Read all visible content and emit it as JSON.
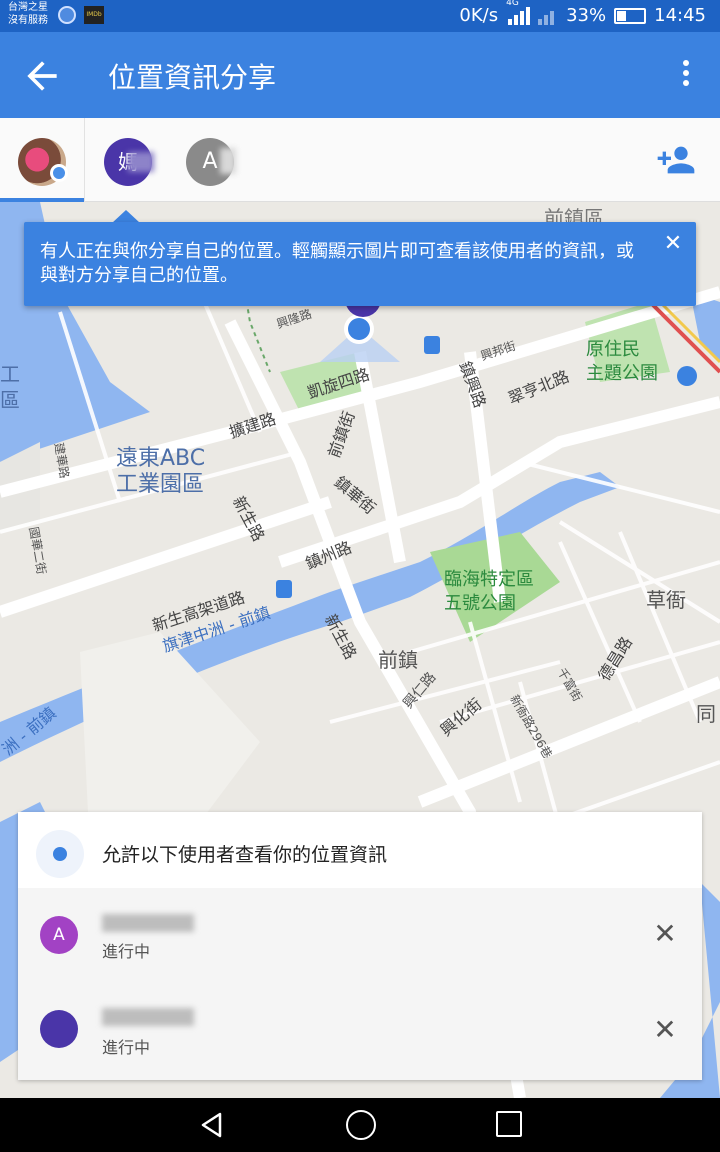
{
  "status_bar": {
    "carrier_line1": "台灣之星",
    "carrier_line2": "沒有服務",
    "app_icon_text": "IMDb",
    "net_speed": "0K/s",
    "net_type": "4G",
    "battery": "33%",
    "time": "14:45"
  },
  "app_bar": {
    "title": "位置資訊分享",
    "back_icon": "arrow-back-icon",
    "menu_icon": "more-vert-icon"
  },
  "avatars": {
    "second_initial": "媽",
    "third_initial": "A",
    "add_icon": "person-add-icon"
  },
  "tooltip": {
    "text": "有人正在與你分享自己的位置。輕觸顯示圖片即可查看該使用者的資訊，或與對方分享自己的位置。",
    "close": "✕"
  },
  "map_labels": {
    "far_east": "遠東ABC\n工業園區",
    "park1": "臨海特定區\n五號公園",
    "park2": "原住民\n主題公園",
    "qianzhen": "前鎮",
    "caoya": "草衙",
    "qianzhen_top": "前鎮區",
    "expressway": "新生高架道路",
    "river": "旗津中洲 - 前鎮",
    "river_left": "洲 - 前鎮",
    "r1": "凱旋四路",
    "r2": "擴建路",
    "r3": "新生路",
    "r4": "鎮州路",
    "r5": "前鎮街",
    "r6": "鎮華街",
    "r7": "鎮興路",
    "r8": "翠亨北路",
    "r9": "興仁路",
    "r10": "興化街",
    "r11": "新生路",
    "r12": "新衙路296巷",
    "r13": "德昌路",
    "r14": "千富街",
    "r15": "興邦街",
    "r16": "興隆路",
    "r17": "國華二街",
    "r18": "建華路",
    "r19": "工",
    "r20": "區",
    "r21": "同"
  },
  "sheet": {
    "title": "允許以下使用者查看你的位置資訊",
    "rows": [
      {
        "initial": "A",
        "status": "進行中",
        "color": "#a242c4"
      },
      {
        "initial": "",
        "status": "進行中",
        "color": "#4a35a8"
      }
    ],
    "remove_icon": "✕"
  },
  "colors": {
    "primary": "#3b82e0",
    "status_bar": "#1e63c4"
  }
}
